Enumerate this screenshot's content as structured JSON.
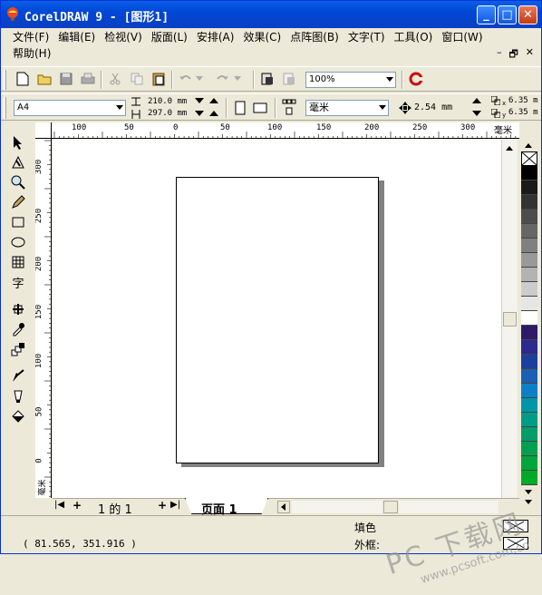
{
  "window": {
    "title": "CorelDRAW 9 - [图形1]",
    "controls": {
      "minimize": "_",
      "maximize": "□",
      "close": "✕"
    }
  },
  "menu": {
    "row1": [
      "文件(F)",
      "编辑(E)",
      "检视(V)",
      "版面(L)",
      "安排(A)",
      "效果(C)",
      "点阵图(B)",
      "文字(T)",
      "工具(O)",
      "窗口(W)"
    ],
    "row2": [
      "帮助(H)"
    ],
    "mdi_controls": [
      "–",
      "🗗",
      "✕"
    ]
  },
  "standard_toolbar": {
    "zoom_value": "100%"
  },
  "property_bar": {
    "paper_size": "A4",
    "width": "210.0 mm",
    "height": "297.0 mm",
    "units": "毫米",
    "nudge": "2.54 mm",
    "dup_x": "6.35 m",
    "dup_y": "6.35 m",
    "dup_x_label": "x",
    "dup_y_label": "y"
  },
  "rulers": {
    "h_labels": [
      "100",
      "50",
      "0",
      "50",
      "100",
      "150",
      "200",
      "250",
      "300"
    ],
    "h_unit": "毫米",
    "v_labels": [
      "300",
      "250",
      "200",
      "150",
      "100",
      "50",
      "0"
    ],
    "v_unit": "毫米"
  },
  "page_nav": {
    "first": "|◀",
    "prev_add": "+",
    "page_of": "1 的 1",
    "next_add": "+",
    "last": "▶|",
    "tab_label": "页面 1"
  },
  "status": {
    "coords": "( 81.565, 351.916 )",
    "fill_label": "填色",
    "outline_label": "外框:"
  },
  "watermark": {
    "big": "PC 下载网",
    "url": "www.pcsoft.com.cn"
  },
  "palette": {
    "colors": [
      "#000000",
      "#1a1a1a",
      "#333333",
      "#4d4d4d",
      "#666666",
      "#808080",
      "#999999",
      "#b3b3b3",
      "#cccccc",
      "#e6e6e6",
      "#ffffff",
      "#2e1a6b",
      "#2c2a8c",
      "#1c3f9e",
      "#1a5fb0",
      "#0d7fc7",
      "#0096a8",
      "#009c86",
      "#009c6a",
      "#00a050",
      "#00a63c",
      "#00aa28"
    ]
  }
}
